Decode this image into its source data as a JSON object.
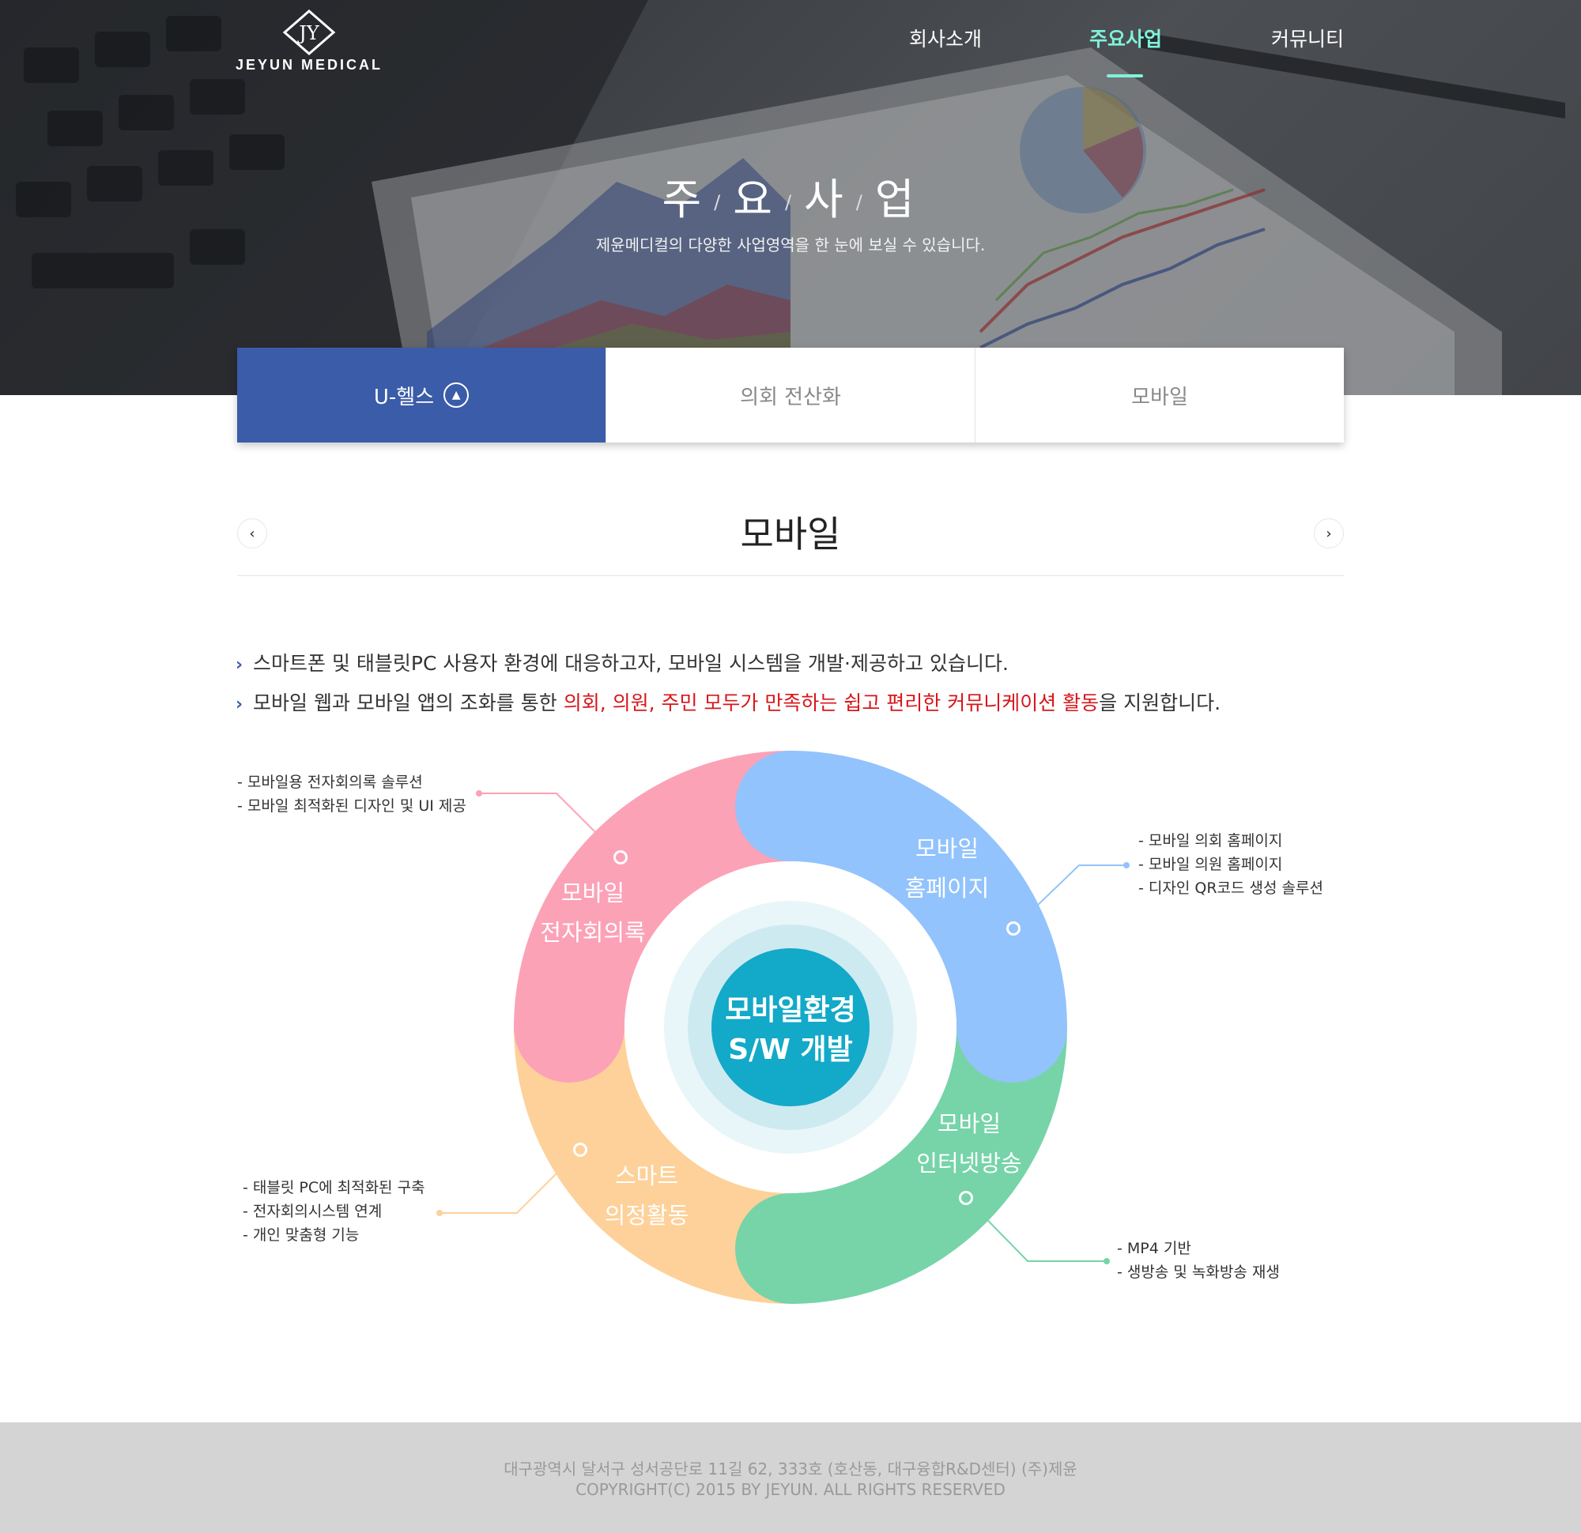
{
  "logo": {
    "text": "JEYUN MEDICAL"
  },
  "nav": {
    "items": [
      "회사소개",
      "주요사업",
      "커뮤니티"
    ],
    "active_index": 1
  },
  "hero": {
    "title_chars": [
      "주",
      "요",
      "사",
      "업"
    ],
    "subtitle": "제윤메디컬의 다양한 사업영역을 한 눈에 보실 수 있습니다."
  },
  "tabs": [
    {
      "label": "U-헬스",
      "active": true
    },
    {
      "label": "의회 전산화",
      "active": false
    },
    {
      "label": "모바일",
      "active": false
    }
  ],
  "section": {
    "title": "모바일",
    "prev_icon": "chevron-left-icon",
    "next_icon": "chevron-right-icon"
  },
  "bullets": {
    "line1": "스마트폰 및 태블릿PC 사용자 환경에 대응하고자, 모바일 시스템을 개발·제공하고 있습니다.",
    "line2_pre": "모바일 웹과 모바일 앱의 조화를 통한 ",
    "line2_highlight": "의회, 의원, 주민 모두가 만족하는 쉽고 편리한 커뮤니케이션 활동",
    "line2_post": "을 지원합니다."
  },
  "diagram": {
    "center": {
      "line1": "모바일환경",
      "line2": "S/W 개발"
    },
    "segments": [
      {
        "line1": "모바일",
        "line2": "전자회의록",
        "color": "#fca2b6"
      },
      {
        "line1": "모바일",
        "line2": "홈페이지",
        "color": "#92c3fc"
      },
      {
        "line1": "모바일",
        "line2": "인터넷방송",
        "color": "#76d4a8"
      },
      {
        "line1": "스마트",
        "line2": "의정활동",
        "color": "#fdd199"
      }
    ],
    "notes": {
      "e_minutes": [
        "- 모바일용 전자회의록 솔루션",
        "- 모바일 최적화된 디자인 및 UI 제공"
      ],
      "homepage": [
        "- 모바일 의회 홈페이지",
        "- 모바일 의원 홈페이지",
        "- 디자인  QR코드 생성 솔루션"
      ],
      "broadcast": [
        "- MP4 기반",
        "- 생방송 및 녹화방송 재생"
      ],
      "smart": [
        "- 태블릿 PC에 최적화된 구축",
        "- 전자회의시스템 연계",
        "- 개인 맞춤형 기능"
      ]
    },
    "center_color": "#13a9c8"
  },
  "footer": {
    "address": "대구광역시 달서구 성서공단로 11길 62, 333호 (호산동, 대구융합R&D센터) (주)제윤",
    "copyright": "COPYRIGHT(C) 2015 BY JEYUN. ALL RIGHTS RESERVED"
  },
  "colors": {
    "accent": "#7ff2dc",
    "tab_active": "#3b5ca8",
    "highlight": "#d8161b",
    "footer_bg": "#d4d4d4"
  }
}
